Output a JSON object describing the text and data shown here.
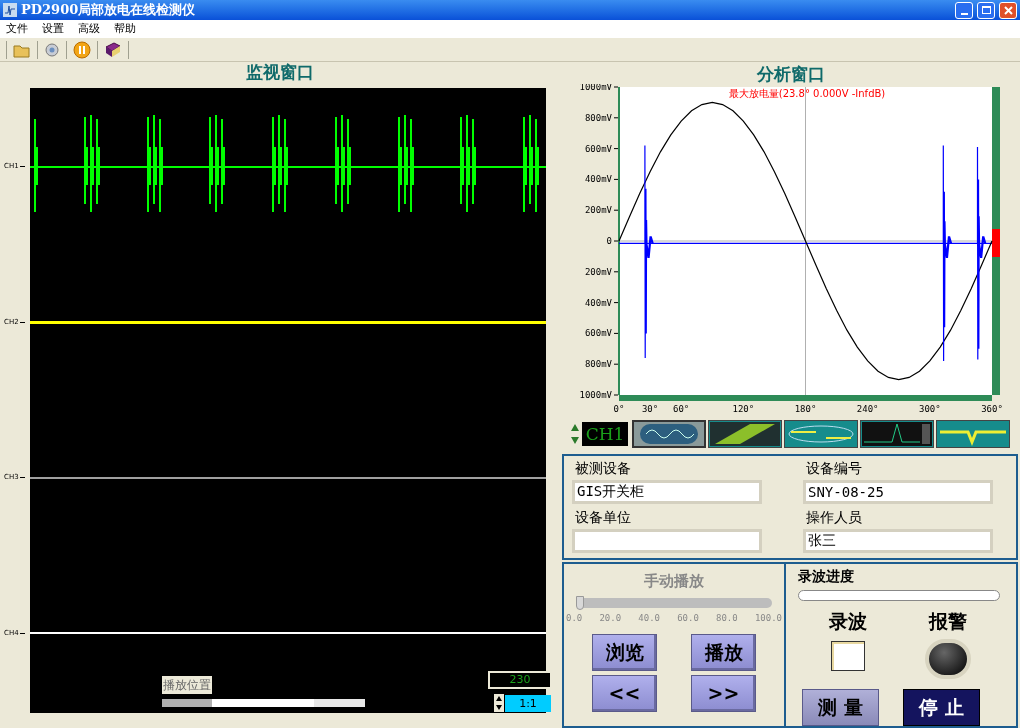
{
  "window": {
    "title": "PD2900局部放电在线检测仪"
  },
  "menu": [
    "文件",
    "设置",
    "高级",
    "帮助"
  ],
  "monitor": {
    "title": "监视窗口",
    "channels": [
      {
        "label": "CH1",
        "color": "#00ff00"
      },
      {
        "label": "CH2",
        "color": "#ffff00"
      },
      {
        "label": "CH3",
        "color": "#a0a0a0"
      },
      {
        "label": "CH4",
        "color": "#ffffff"
      }
    ],
    "playback_label": "播放位置",
    "counter": "230",
    "ratio": "1:1"
  },
  "analysis": {
    "title": "分析窗口",
    "channel": "CH1",
    "chart_data": {
      "type": "line",
      "title": "最大放电量(23.8° 0.000V -InfdB)",
      "xlim": [
        0,
        360
      ],
      "ylim": [
        -1000,
        1000
      ],
      "x": [
        0,
        10,
        20,
        30,
        40,
        50,
        60,
        70,
        80,
        90,
        100,
        110,
        120,
        130,
        140,
        150,
        160,
        170,
        180,
        190,
        200,
        210,
        220,
        230,
        240,
        250,
        260,
        270,
        280,
        290,
        300,
        310,
        320,
        330,
        340,
        350,
        360
      ],
      "series": [
        {
          "color": "#000000",
          "values": [
            0,
            156,
            308,
            450,
            579,
            689,
            779,
            846,
            886,
            900,
            886,
            846,
            779,
            689,
            579,
            450,
            308,
            156,
            0,
            -156,
            -308,
            -450,
            -579,
            -689,
            -779,
            -846,
            -886,
            -900,
            -886,
            -846,
            -779,
            -689,
            -579,
            -450,
            -308,
            -156,
            0
          ]
        },
        {
          "color": "#0000ff",
          "values": [
            -15,
            -15,
            -15,
            -15,
            -15,
            -15,
            -15,
            -15,
            -15,
            -15,
            -15,
            -15,
            -15,
            -15,
            -15,
            -15,
            -15,
            -15,
            -15,
            -15,
            -15,
            -15,
            -15,
            -15,
            -15,
            -15,
            -15,
            -15,
            -15,
            -15,
            -15,
            -15,
            -15,
            -15,
            -15,
            -15,
            -15
          ]
        }
      ],
      "xticks": [
        {
          "value": 0,
          "label": "0°"
        },
        {
          "value": 30,
          "label": "30°"
        },
        {
          "value": 60,
          "label": "60°"
        },
        {
          "value": 120,
          "label": "120°"
        },
        {
          "value": 180,
          "label": "180°"
        },
        {
          "value": 240,
          "label": "240°"
        },
        {
          "value": 300,
          "label": "300°"
        },
        {
          "value": 360,
          "label": "360°"
        }
      ],
      "yticks": [
        {
          "value": 1000,
          "label": "1000mV"
        },
        {
          "value": 800,
          "label": "800mV"
        },
        {
          "value": 600,
          "label": "600mV"
        },
        {
          "value": 400,
          "label": "400mV"
        },
        {
          "value": 200,
          "label": "200mV"
        },
        {
          "value": 0,
          "label": "0"
        },
        {
          "value": -200,
          "label": "200mV"
        },
        {
          "value": -400,
          "label": "400mV"
        },
        {
          "value": -600,
          "label": "600mV"
        },
        {
          "value": -800,
          "label": "800mV"
        },
        {
          "value": -1000,
          "label": "1000mV"
        }
      ]
    },
    "views": [
      {
        "kind": "scope",
        "selected": true
      },
      {
        "kind": "prpd",
        "selected": false
      },
      {
        "kind": "ellipse",
        "selected": false
      },
      {
        "kind": "spectrum",
        "selected": false
      },
      {
        "kind": "trend",
        "selected": false
      }
    ]
  },
  "device_info": {
    "fields": [
      {
        "label": "被测设备",
        "value": "GIS开关柜"
      },
      {
        "label": "设备编号",
        "value": "SNY-08-25"
      },
      {
        "label": "设备单位"
      },
      {
        "label": "操作人员",
        "value": "张三"
      }
    ]
  },
  "playback": {
    "title": "手动播放",
    "slider": {
      "level": 0
    },
    "ticks": [
      "0.0",
      "20.0",
      "40.0",
      "60.0",
      "80.0",
      "100.0"
    ],
    "buttons": [
      "浏览",
      "播放",
      "<<",
      ">>"
    ]
  },
  "recording": {
    "title": "录波进度",
    "progress": {
      "level": 0
    },
    "record": {
      "label": "录波",
      "checked": false
    },
    "alarm": {
      "label": "报警",
      "on": false
    },
    "buttons": [
      {
        "label": "测 量",
        "kind": "normal"
      },
      {
        "label": "停 止",
        "kind": "primary"
      }
    ]
  }
}
